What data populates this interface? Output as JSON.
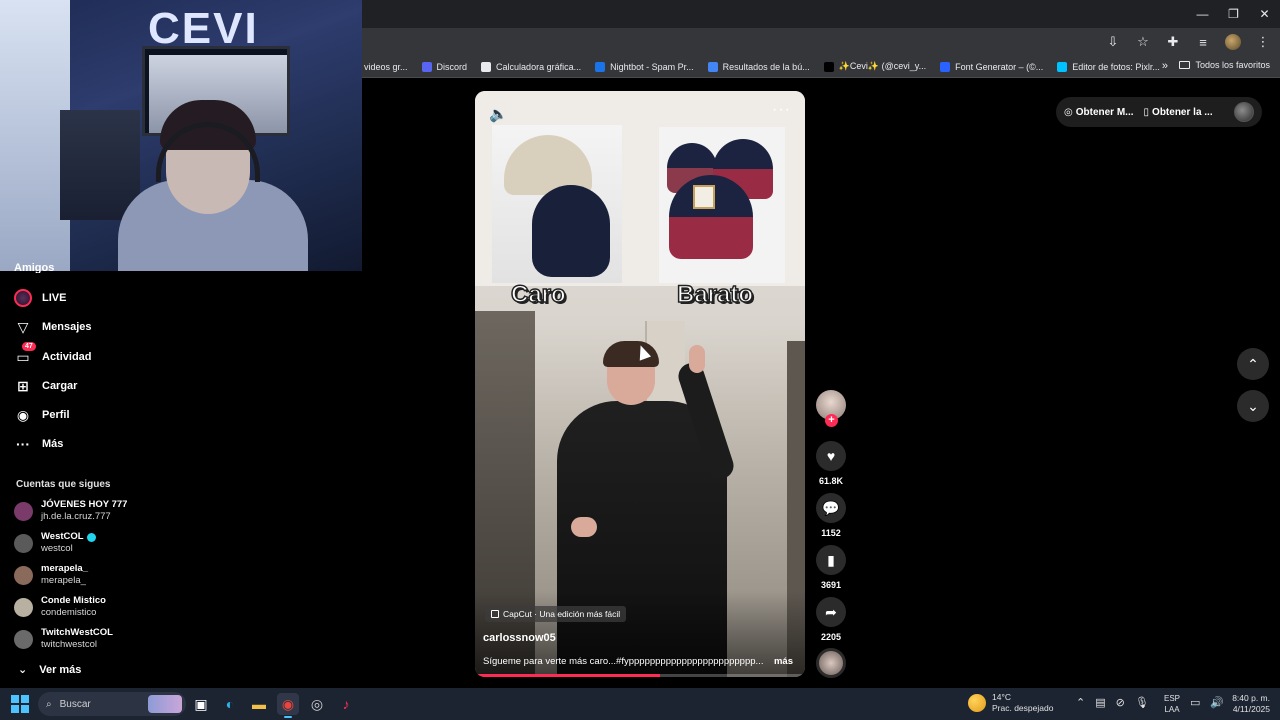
{
  "browser": {
    "window_controls": {
      "minimize": "—",
      "restore": "❐",
      "close": "✕"
    },
    "bookmarks": [
      {
        "label": "videos gr...",
        "color": "#888888"
      },
      {
        "label": "Discord",
        "color": "#5865f2"
      },
      {
        "label": "Calculadora gráfica...",
        "color": "#e8eaed"
      },
      {
        "label": "Nightbot - Spam Pr...",
        "color": "#1a73e8"
      },
      {
        "label": "Resultados de la bú...",
        "color": "#4285f4"
      },
      {
        "label": "✨Cevi✨ (@cevi_y...",
        "color": "#000000"
      },
      {
        "label": "Font Generator – (©...",
        "color": "#2962ff"
      },
      {
        "label": "Editor de fotos: Pixlr...",
        "color": "#00c2ff"
      }
    ],
    "bookmarks_more": "»",
    "all_bookmarks": "Todos los favoritos"
  },
  "webcam": {
    "logo_text": "CEVI"
  },
  "sidebar": {
    "partial_item": "Amigos",
    "items": [
      {
        "label": "LIVE",
        "icon": "live-icon"
      },
      {
        "label": "Mensajes",
        "icon": "send-icon"
      },
      {
        "label": "Actividad",
        "icon": "inbox-icon",
        "badge": "47"
      },
      {
        "label": "Cargar",
        "icon": "upload-icon"
      },
      {
        "label": "Perfil",
        "icon": "profile-icon"
      },
      {
        "label": "Más",
        "icon": "more-icon"
      }
    ],
    "following_heading": "Cuentas que sigues",
    "following": [
      {
        "name": "JÓVENES HOY 777",
        "handle": "jh.de.la.cruz.777",
        "verified": false,
        "color": "#7a3a6a"
      },
      {
        "name": "WestCOL",
        "handle": "westcol",
        "verified": true,
        "color": "#5a5a5a"
      },
      {
        "name": "merapela_",
        "handle": "merapela_",
        "verified": false,
        "color": "#8a6a5a"
      },
      {
        "name": "Conde Mistico",
        "handle": "condemistico",
        "verified": false,
        "color": "#b8b0a0"
      },
      {
        "name": "TwitchWestCOL",
        "handle": "twitchwestcol",
        "verified": false,
        "color": "#6a6a6a"
      }
    ],
    "see_more": "Ver más"
  },
  "top_pills": {
    "get_coins": "Obtener M...",
    "get_app": "Obtener la ..."
  },
  "video": {
    "label_left": "Caro",
    "label_right": "Barato",
    "capcut_tag": "CapCut · Una edición más fácil",
    "author": "carlossnow05",
    "caption": "Sígueme para verte más caro...#fypppppppppppppppppppppppp...",
    "caption_more": "más",
    "progress": 0.56
  },
  "actions": {
    "likes": "61.8K",
    "comments": "1152",
    "saves": "3691",
    "shares": "2205"
  },
  "taskbar": {
    "search_label": "Buscar",
    "weather_temp": "14°C",
    "weather_desc": "Prac. despejado",
    "lang_top": "ESP",
    "lang_bottom": "LAA",
    "time": "8:40 p. m.",
    "date": "4/11/2025"
  }
}
